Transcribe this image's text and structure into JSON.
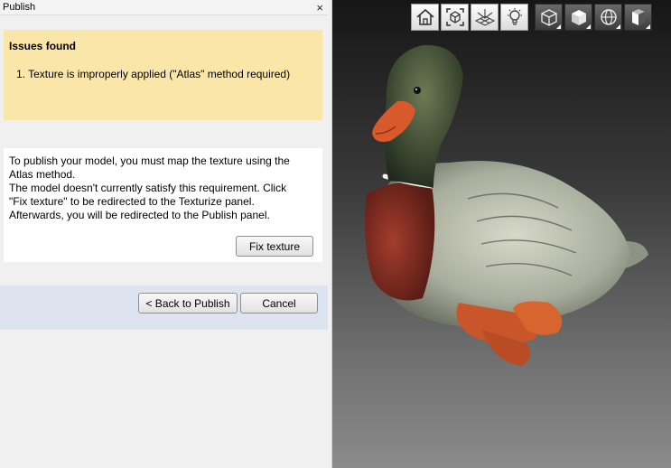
{
  "panel": {
    "title": "Publish",
    "close_glyph": "×"
  },
  "issues": {
    "heading": "Issues found",
    "items": [
      "1.  Texture is improperly applied (\"Atlas\" method required)"
    ],
    "background_color": "#fbe6a9"
  },
  "info": {
    "message": "To publish your model, you must map the texture using the\nAtlas method.\n The model doesn't currently satisfy this requirement. Click\n\"Fix texture\" to be redirected to the Texturize panel.\nAfterwards, you will be redirected to the Publish panel.",
    "fix_label": "Fix texture"
  },
  "actions": {
    "back_label": "< Back to Publish",
    "cancel_label": "Cancel",
    "background_color": "#dde3ef"
  },
  "viewport": {
    "toolbar": [
      {
        "icon": "home-icon",
        "style": "light"
      },
      {
        "icon": "fit-cube-icon",
        "style": "light"
      },
      {
        "icon": "grid-icon",
        "style": "light"
      },
      {
        "icon": "lightbulb-icon",
        "style": "light"
      },
      {
        "icon": "wireframe-cube-icon",
        "style": "dark"
      },
      {
        "icon": "solid-cube-icon",
        "style": "dark"
      },
      {
        "icon": "sphere-icon",
        "style": "dark"
      },
      {
        "icon": "shaded-box-icon",
        "style": "dark"
      }
    ]
  }
}
